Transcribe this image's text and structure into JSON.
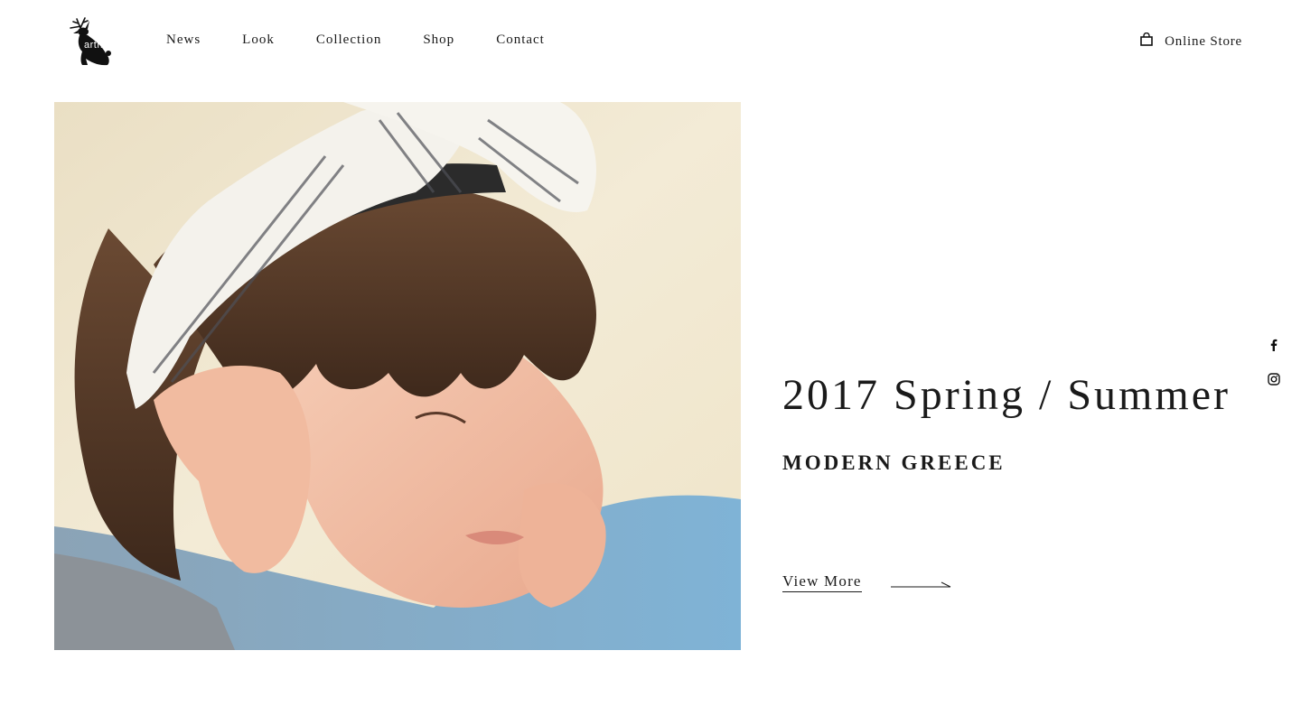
{
  "brand": {
    "logo_text": "arth"
  },
  "nav": {
    "items": [
      {
        "label": "News"
      },
      {
        "label": "Look"
      },
      {
        "label": "Collection"
      },
      {
        "label": "Shop"
      },
      {
        "label": "Contact"
      }
    ],
    "online_store_label": "Online Store"
  },
  "hero": {
    "season": "2017 Spring / Summer",
    "collection": "MODERN GREECE",
    "view_more_label": "View More"
  },
  "icons": {
    "logo": "jackalope-logo",
    "bag": "shopping-bag-icon",
    "arrow": "arrow-right-icon",
    "facebook": "facebook-icon",
    "instagram": "instagram-icon"
  },
  "colors": {
    "text": "#1a1a1a",
    "background": "#ffffff"
  }
}
